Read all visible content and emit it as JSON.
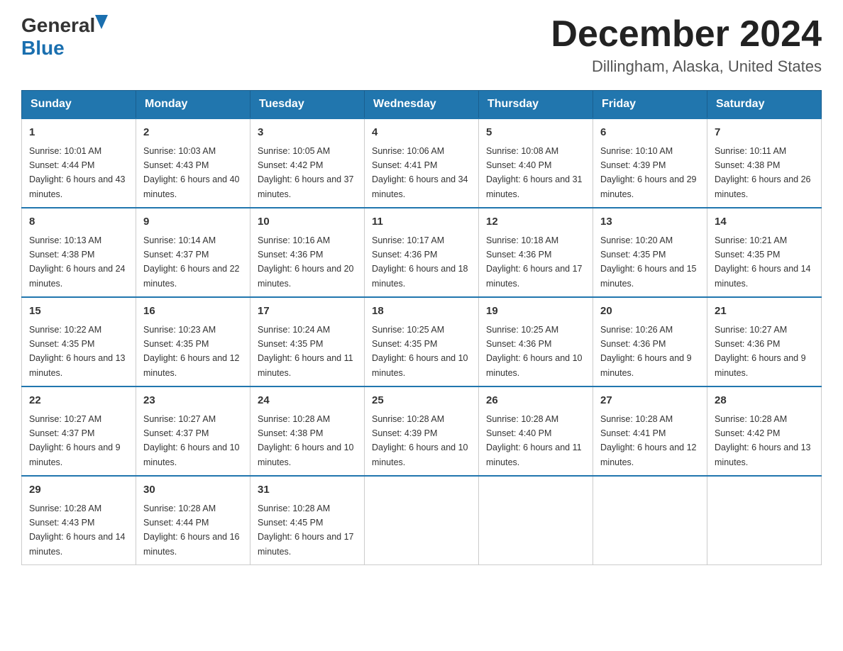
{
  "header": {
    "logo_general": "General",
    "logo_blue": "Blue",
    "month_year": "December 2024",
    "location": "Dillingham, Alaska, United States"
  },
  "days_of_week": [
    "Sunday",
    "Monday",
    "Tuesday",
    "Wednesday",
    "Thursday",
    "Friday",
    "Saturday"
  ],
  "weeks": [
    [
      {
        "day": "1",
        "sunrise": "10:01 AM",
        "sunset": "4:44 PM",
        "daylight": "6 hours and 43 minutes."
      },
      {
        "day": "2",
        "sunrise": "10:03 AM",
        "sunset": "4:43 PM",
        "daylight": "6 hours and 40 minutes."
      },
      {
        "day": "3",
        "sunrise": "10:05 AM",
        "sunset": "4:42 PM",
        "daylight": "6 hours and 37 minutes."
      },
      {
        "day": "4",
        "sunrise": "10:06 AM",
        "sunset": "4:41 PM",
        "daylight": "6 hours and 34 minutes."
      },
      {
        "day": "5",
        "sunrise": "10:08 AM",
        "sunset": "4:40 PM",
        "daylight": "6 hours and 31 minutes."
      },
      {
        "day": "6",
        "sunrise": "10:10 AM",
        "sunset": "4:39 PM",
        "daylight": "6 hours and 29 minutes."
      },
      {
        "day": "7",
        "sunrise": "10:11 AM",
        "sunset": "4:38 PM",
        "daylight": "6 hours and 26 minutes."
      }
    ],
    [
      {
        "day": "8",
        "sunrise": "10:13 AM",
        "sunset": "4:38 PM",
        "daylight": "6 hours and 24 minutes."
      },
      {
        "day": "9",
        "sunrise": "10:14 AM",
        "sunset": "4:37 PM",
        "daylight": "6 hours and 22 minutes."
      },
      {
        "day": "10",
        "sunrise": "10:16 AM",
        "sunset": "4:36 PM",
        "daylight": "6 hours and 20 minutes."
      },
      {
        "day": "11",
        "sunrise": "10:17 AM",
        "sunset": "4:36 PM",
        "daylight": "6 hours and 18 minutes."
      },
      {
        "day": "12",
        "sunrise": "10:18 AM",
        "sunset": "4:36 PM",
        "daylight": "6 hours and 17 minutes."
      },
      {
        "day": "13",
        "sunrise": "10:20 AM",
        "sunset": "4:35 PM",
        "daylight": "6 hours and 15 minutes."
      },
      {
        "day": "14",
        "sunrise": "10:21 AM",
        "sunset": "4:35 PM",
        "daylight": "6 hours and 14 minutes."
      }
    ],
    [
      {
        "day": "15",
        "sunrise": "10:22 AM",
        "sunset": "4:35 PM",
        "daylight": "6 hours and 13 minutes."
      },
      {
        "day": "16",
        "sunrise": "10:23 AM",
        "sunset": "4:35 PM",
        "daylight": "6 hours and 12 minutes."
      },
      {
        "day": "17",
        "sunrise": "10:24 AM",
        "sunset": "4:35 PM",
        "daylight": "6 hours and 11 minutes."
      },
      {
        "day": "18",
        "sunrise": "10:25 AM",
        "sunset": "4:35 PM",
        "daylight": "6 hours and 10 minutes."
      },
      {
        "day": "19",
        "sunrise": "10:25 AM",
        "sunset": "4:36 PM",
        "daylight": "6 hours and 10 minutes."
      },
      {
        "day": "20",
        "sunrise": "10:26 AM",
        "sunset": "4:36 PM",
        "daylight": "6 hours and 9 minutes."
      },
      {
        "day": "21",
        "sunrise": "10:27 AM",
        "sunset": "4:36 PM",
        "daylight": "6 hours and 9 minutes."
      }
    ],
    [
      {
        "day": "22",
        "sunrise": "10:27 AM",
        "sunset": "4:37 PM",
        "daylight": "6 hours and 9 minutes."
      },
      {
        "day": "23",
        "sunrise": "10:27 AM",
        "sunset": "4:37 PM",
        "daylight": "6 hours and 10 minutes."
      },
      {
        "day": "24",
        "sunrise": "10:28 AM",
        "sunset": "4:38 PM",
        "daylight": "6 hours and 10 minutes."
      },
      {
        "day": "25",
        "sunrise": "10:28 AM",
        "sunset": "4:39 PM",
        "daylight": "6 hours and 10 minutes."
      },
      {
        "day": "26",
        "sunrise": "10:28 AM",
        "sunset": "4:40 PM",
        "daylight": "6 hours and 11 minutes."
      },
      {
        "day": "27",
        "sunrise": "10:28 AM",
        "sunset": "4:41 PM",
        "daylight": "6 hours and 12 minutes."
      },
      {
        "day": "28",
        "sunrise": "10:28 AM",
        "sunset": "4:42 PM",
        "daylight": "6 hours and 13 minutes."
      }
    ],
    [
      {
        "day": "29",
        "sunrise": "10:28 AM",
        "sunset": "4:43 PM",
        "daylight": "6 hours and 14 minutes."
      },
      {
        "day": "30",
        "sunrise": "10:28 AM",
        "sunset": "4:44 PM",
        "daylight": "6 hours and 16 minutes."
      },
      {
        "day": "31",
        "sunrise": "10:28 AM",
        "sunset": "4:45 PM",
        "daylight": "6 hours and 17 minutes."
      },
      null,
      null,
      null,
      null
    ]
  ]
}
